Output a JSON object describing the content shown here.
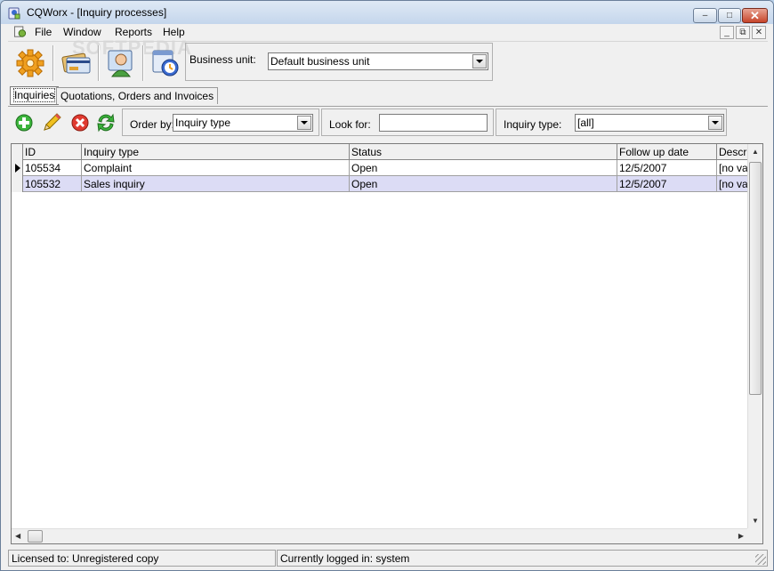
{
  "window": {
    "title": "CQWorx - [Inquiry processes]",
    "minimize": "–",
    "maximize": "□",
    "close": "✕"
  },
  "menubar": {
    "items": [
      "File",
      "Window",
      "Reports",
      "Help"
    ],
    "mdi_min": "_",
    "mdi_restore": "⧉",
    "mdi_close": "✕"
  },
  "watermark": "SOFTPEDIA",
  "toolbar": {
    "icons": [
      "settings-gear-icon",
      "credit-card-icon",
      "contact-person-icon",
      "calendar-clock-icon"
    ],
    "business_unit_label": "Business unit:",
    "business_unit_value": "Default business unit"
  },
  "tabs": [
    {
      "label": "Inquiries",
      "active": true
    },
    {
      "label": "Quotations, Orders and Invoices",
      "active": false
    }
  ],
  "filters": {
    "actions": [
      "add-icon",
      "edit-pencil-icon",
      "delete-icon",
      "refresh-icon"
    ],
    "order_by_label": "Order by:",
    "order_by_value": "Inquiry type",
    "look_for_label": "Look for:",
    "look_for_value": "",
    "inquiry_type_label": "Inquiry type:",
    "inquiry_type_value": "[all]"
  },
  "grid": {
    "columns": [
      "ID",
      "Inquiry type",
      "Status",
      "Follow up date",
      "Description"
    ],
    "rows": [
      {
        "id": "105534",
        "type": "Complaint",
        "status": "Open",
        "followup": "12/5/2007",
        "desc": "[no value]",
        "current": true,
        "selected": false
      },
      {
        "id": "105532",
        "type": "Sales inquiry",
        "status": "Open",
        "followup": "12/5/2007",
        "desc": "[no value]",
        "current": false,
        "selected": true
      }
    ]
  },
  "statusbar": {
    "license": "Licensed to: Unregistered copy",
    "logged_in": "Currently logged in: system"
  },
  "colors": {
    "selected_row": "#dcdcf5",
    "title_gradient_top": "#dfe9f5",
    "close_button": "#c7452a"
  }
}
